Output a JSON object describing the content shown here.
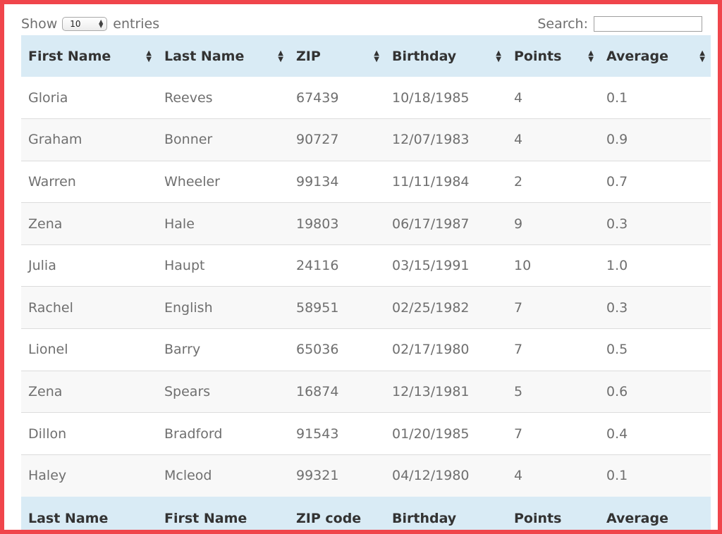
{
  "length_control": {
    "prefix": "Show",
    "selected": "10",
    "suffix": "entries"
  },
  "search": {
    "label": "Search:",
    "value": ""
  },
  "table": {
    "header": [
      "First Name",
      "Last Name",
      "ZIP",
      "Birthday",
      "Points",
      "Average"
    ],
    "rows": [
      [
        "Gloria",
        "Reeves",
        "67439",
        "10/18/1985",
        "4",
        "0.1"
      ],
      [
        "Graham",
        "Bonner",
        "90727",
        "12/07/1983",
        "4",
        "0.9"
      ],
      [
        "Warren",
        "Wheeler",
        "99134",
        "11/11/1984",
        "2",
        "0.7"
      ],
      [
        "Zena",
        "Hale",
        "19803",
        "06/17/1987",
        "9",
        "0.3"
      ],
      [
        "Julia",
        "Haupt",
        "24116",
        "03/15/1991",
        "10",
        "1.0"
      ],
      [
        "Rachel",
        "English",
        "58951",
        "02/25/1982",
        "7",
        "0.3"
      ],
      [
        "Lionel",
        "Barry",
        "65036",
        "02/17/1980",
        "7",
        "0.5"
      ],
      [
        "Zena",
        "Spears",
        "16874",
        "12/13/1981",
        "5",
        "0.6"
      ],
      [
        "Dillon",
        "Bradford",
        "91543",
        "01/20/1985",
        "7",
        "0.4"
      ],
      [
        "Haley",
        "Mcleod",
        "99321",
        "04/12/1980",
        "4",
        "0.1"
      ]
    ],
    "footer": [
      "Last Name",
      "First Name",
      "ZIP code",
      "Birthday",
      "Points",
      "Average"
    ]
  },
  "colors": {
    "frame_border": "#f0454b",
    "header_bg": "#d9ebf5",
    "striped_row_bg": "#f8f8f8",
    "text": "#6f6f6f"
  },
  "icons": {
    "sort": "sort-both-icon",
    "select_arrows": "select-arrows-icon"
  }
}
